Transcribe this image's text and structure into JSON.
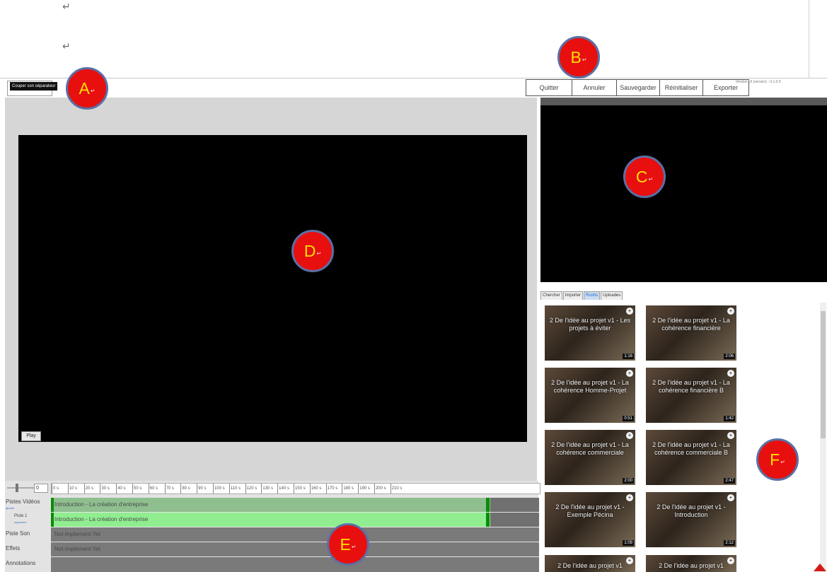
{
  "doc": {
    "para_marks": [
      "↵",
      "↵"
    ]
  },
  "left_toolbar": {
    "tooltip": "Couper son séparateur"
  },
  "toolbar": {
    "buttons": [
      "Quitter",
      "Annuler",
      "Sauvegarder",
      "Réinitialiser",
      "Exporter"
    ],
    "version_text": "Version UI (version) - 0.1.0.5"
  },
  "player": {
    "play_label": "Play"
  },
  "media": {
    "tabs": [
      {
        "label": "Chercher",
        "active": false
      },
      {
        "label": "Importer",
        "active": false
      },
      {
        "label": "Rushs",
        "active": true
      },
      {
        "label": "Uploades",
        "active": false
      }
    ],
    "items": [
      {
        "title": "2 De l'idée au projet v1 - Les projets à éviter",
        "duration": "1:16"
      },
      {
        "title": "2 De l'idée au projet v1 - La cohérence financière",
        "duration": "2:06"
      },
      {
        "title": "2 De l'idée au projet v1 - La cohérence Homme-Projet",
        "duration": "0:51"
      },
      {
        "title": "2 De l'idée au projet v1 - La cohérence financière B",
        "duration": "1:42"
      },
      {
        "title": "2 De l'idée au projet v1 - La cohérence commerciale",
        "duration": "2:00"
      },
      {
        "title": "2 De l'idée au projet v1 - La cohérence commerciale B",
        "duration": "2:47"
      },
      {
        "title": "2 De l'idée au projet v1 - Exemple Pécina",
        "duration": "1:09"
      },
      {
        "title": "2 De l'idée au projet v1 - Introduction",
        "duration": "2:12"
      },
      {
        "title": "2 De l'idée au projet v1",
        "duration": ""
      },
      {
        "title": "2 De l'idée au projet v1",
        "duration": ""
      }
    ]
  },
  "timeline": {
    "zoom_value": "0",
    "ruler_ticks": [
      "0 s",
      "10 s",
      "20 s",
      "30 s",
      "40 s",
      "50 s",
      "60 s",
      "70 s",
      "80 s",
      "90 s",
      "100 s",
      "110 s",
      "120 s",
      "130 s",
      "140 s",
      "150 s",
      "160 s",
      "170 s",
      "180 s",
      "190 s",
      "200 s",
      "210 s"
    ],
    "tracks": [
      {
        "label": "Pistes Vidéos",
        "sub": "ajouter",
        "clip": "Introduction - La création d'entreprise"
      },
      {
        "label": "Piste 1",
        "sub": "supprimer",
        "clip": "Introduction - La création d'entreprise"
      },
      {
        "label": "Piste Son",
        "sub": "",
        "clip": "Not implement Yet"
      },
      {
        "label": "Effets",
        "sub": "",
        "clip": "Not implement Yet"
      },
      {
        "label": "Annotations",
        "sub": "",
        "clip": ""
      }
    ]
  },
  "markers": [
    {
      "letter": "A",
      "mark": "↵"
    },
    {
      "letter": "B",
      "mark": "↵"
    },
    {
      "letter": "C",
      "mark": "↵"
    },
    {
      "letter": "D",
      "mark": "↵"
    },
    {
      "letter": "E",
      "mark": "↵"
    },
    {
      "letter": "F",
      "mark": "↵"
    }
  ],
  "colors": {
    "marker_fill": "#e80f0f",
    "marker_letter": "#ffe000",
    "clip_green": "#90dd90",
    "clip_dark": "#0d8a0d"
  }
}
